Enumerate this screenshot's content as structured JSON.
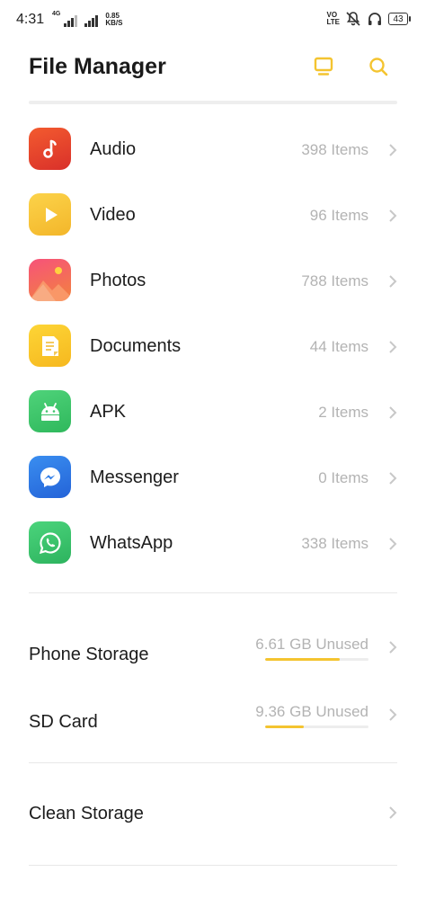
{
  "status_bar": {
    "time": "4:31",
    "signal_tag": "4G",
    "net_speed_value": "0.85",
    "net_speed_unit": "KB/S",
    "volte_line1": "VO",
    "volte_line2": "LTE",
    "battery": "43"
  },
  "header": {
    "title": "File Manager",
    "accent_color": "#f4c430"
  },
  "categories": [
    {
      "label": "Audio",
      "count": "398 Items",
      "icon": "music-note-icon",
      "color": "#e8402a"
    },
    {
      "label": "Video",
      "count": "96 Items",
      "icon": "play-icon",
      "color": "#f6c531"
    },
    {
      "label": "Photos",
      "count": "788 Items",
      "icon": "photo-icon",
      "color": "#f4596a"
    },
    {
      "label": "Documents",
      "count": "44 Items",
      "icon": "document-icon",
      "color": "#fbc92b"
    },
    {
      "label": "APK",
      "count": "2 Items",
      "icon": "android-icon",
      "color": "#3dc56a"
    },
    {
      "label": "Messenger",
      "count": "0 Items",
      "icon": "messenger-icon",
      "color": "#2f7de8"
    },
    {
      "label": "WhatsApp",
      "count": "338 Items",
      "icon": "whatsapp-icon",
      "color": "#3ec46d"
    }
  ],
  "storage": [
    {
      "label": "Phone Storage",
      "value": "6.61 GB Unused",
      "used_fraction": 0.72
    },
    {
      "label": "SD Card",
      "value": "9.36 GB Unused",
      "used_fraction": 0.37
    }
  ],
  "clean": {
    "label": "Clean Storage"
  }
}
